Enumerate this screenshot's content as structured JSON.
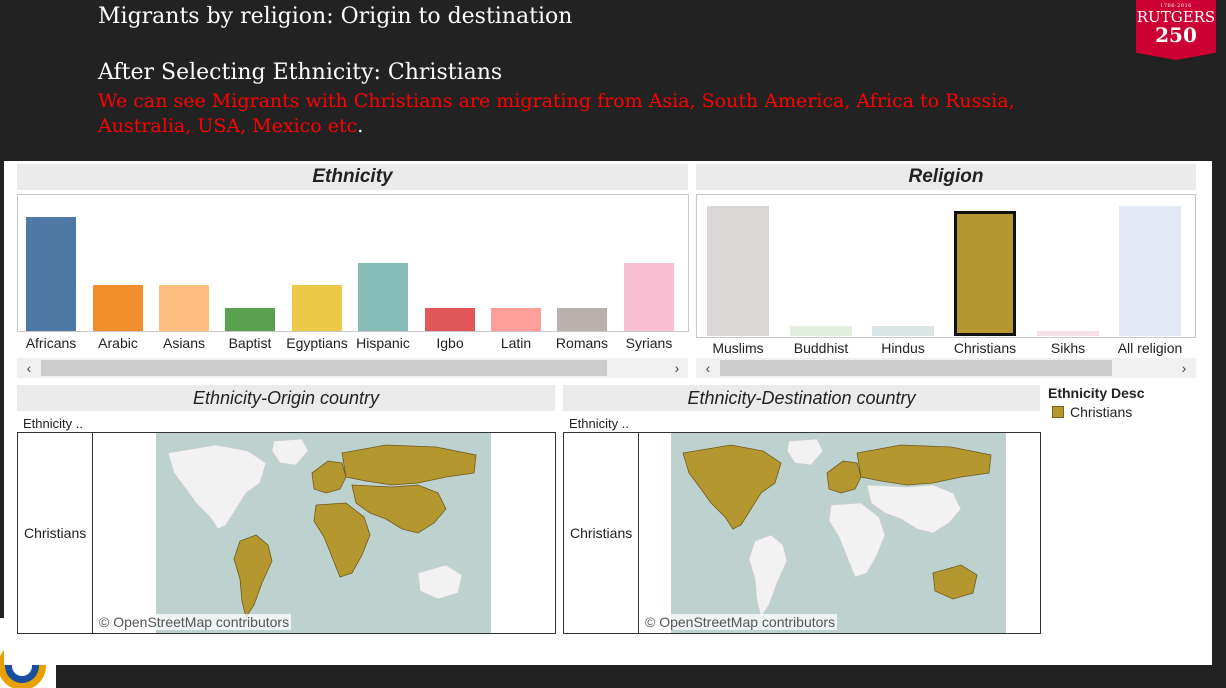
{
  "slide": {
    "title": "Migrants by religion: Origin to destination",
    "subtitle": "After Selecting Ethnicity: Christians",
    "description": "We can see Migrants with Christians are migrating from Asia, South America, Africa to Russia, Australia, USA, Mexico etc",
    "description_end": "."
  },
  "logo": {
    "years": "1766-2016",
    "name": "RUTGERS",
    "number": "250"
  },
  "panels": {
    "ethnicity_title": "Ethnicity",
    "religion_title": "Religion",
    "origin_map_title": "Ethnicity-Origin country",
    "destination_map_title": "Ethnicity-Destination country"
  },
  "chart_data": [
    {
      "type": "bar",
      "title": "Ethnicity",
      "categories": [
        "Africans",
        "Arabic",
        "Asians",
        "Baptist",
        "Egyptians",
        "Hispanic",
        "Igbo",
        "Latin",
        "Romans",
        "Syrians"
      ],
      "values": [
        114,
        46,
        46,
        23,
        46,
        68,
        23,
        23,
        23,
        68
      ],
      "colors": [
        "#4e79a7",
        "#f28e2b",
        "#ffbe7d",
        "#59a14f",
        "#edc948",
        "#86bcb6",
        "#e15759",
        "#ff9d9a",
        "#bab0ac",
        "#fabfd2"
      ]
    },
    {
      "type": "bar",
      "title": "Religion",
      "categories": [
        "Muslims",
        "Buddhist",
        "Hindus",
        "Christians",
        "Sikhs",
        "All religion"
      ],
      "values": [
        100,
        8,
        8,
        96,
        4,
        100
      ],
      "colors": [
        "#dad7d7",
        "#e2efdf",
        "#d9e6e5",
        "#b5972f",
        "#f5e0e6",
        "#e3eaf3"
      ],
      "highlighted": "Christians"
    }
  ],
  "maps": {
    "row_header": "Ethnicity ..",
    "row_value": "Christians",
    "attribution": "© OpenStreetMap contributors",
    "land_color": "#b5972f",
    "base_land_color": "#f2f2f2",
    "water_color": "#bdd1cf"
  },
  "legend": {
    "title": "Ethnicity Desc",
    "item": "Christians"
  },
  "scroll": {
    "left": "‹",
    "right": "›"
  }
}
